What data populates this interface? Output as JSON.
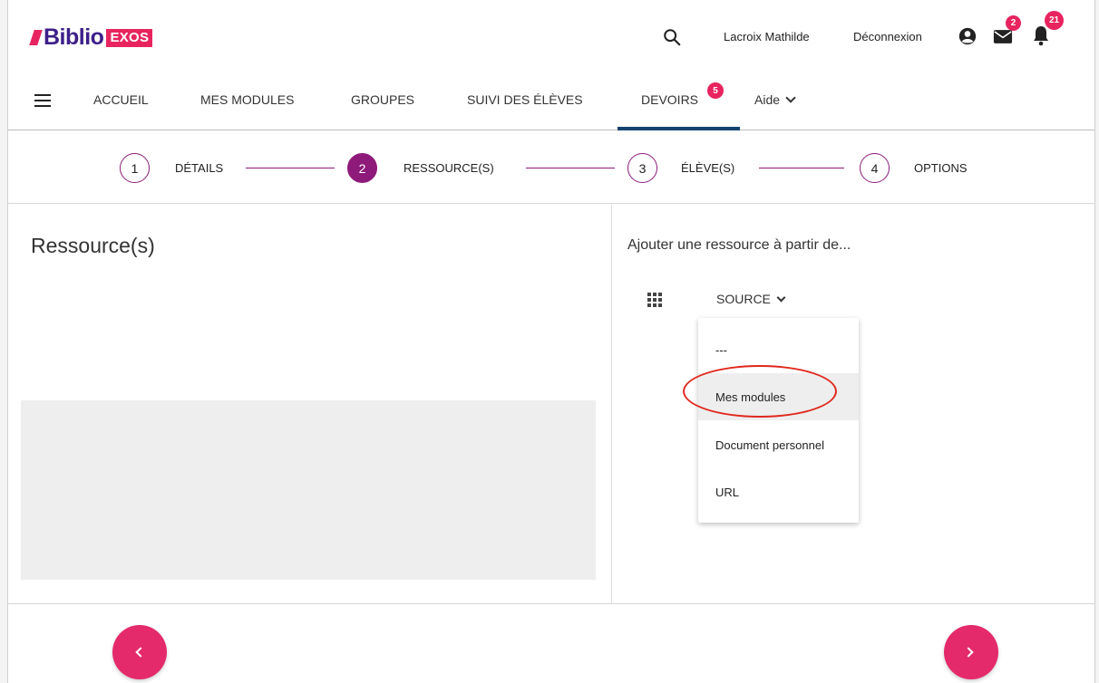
{
  "header": {
    "logo_text": "Biblio",
    "logo_badge": "EXOS",
    "user_name": "Lacroix Mathilde",
    "logout_label": "Déconnexion",
    "mail_count": "2",
    "notification_count": "21"
  },
  "nav": {
    "items": [
      {
        "label": "ACCUEIL"
      },
      {
        "label": "MES MODULES"
      },
      {
        "label": "GROUPES"
      },
      {
        "label": "SUIVI DES ÉLÈVES"
      },
      {
        "label": "DEVOIRS",
        "badge": "5",
        "active": true
      },
      {
        "label": "Aide"
      }
    ]
  },
  "stepper": {
    "steps": [
      {
        "number": "1",
        "label": "DÉTAILS"
      },
      {
        "number": "2",
        "label": "RESSOURCE(S)",
        "active": true
      },
      {
        "number": "3",
        "label": "ÉLÈVE(S)"
      },
      {
        "number": "4",
        "label": "OPTIONS"
      }
    ]
  },
  "left_panel": {
    "title": "Ressource(s)"
  },
  "right_panel": {
    "add_label": "Ajouter une ressource à partir de...",
    "source_label": "SOURCE",
    "dropdown_options": [
      "---",
      "Mes modules",
      "Document personnel",
      "URL"
    ],
    "highlighted_option": "Mes modules"
  },
  "colors": {
    "brand_pink": "#e8245f",
    "brand_purple": "#3d1f8a",
    "step_accent": "#8e1b7a",
    "nav_active": "#14436f",
    "annotation_red": "#e0271c"
  }
}
